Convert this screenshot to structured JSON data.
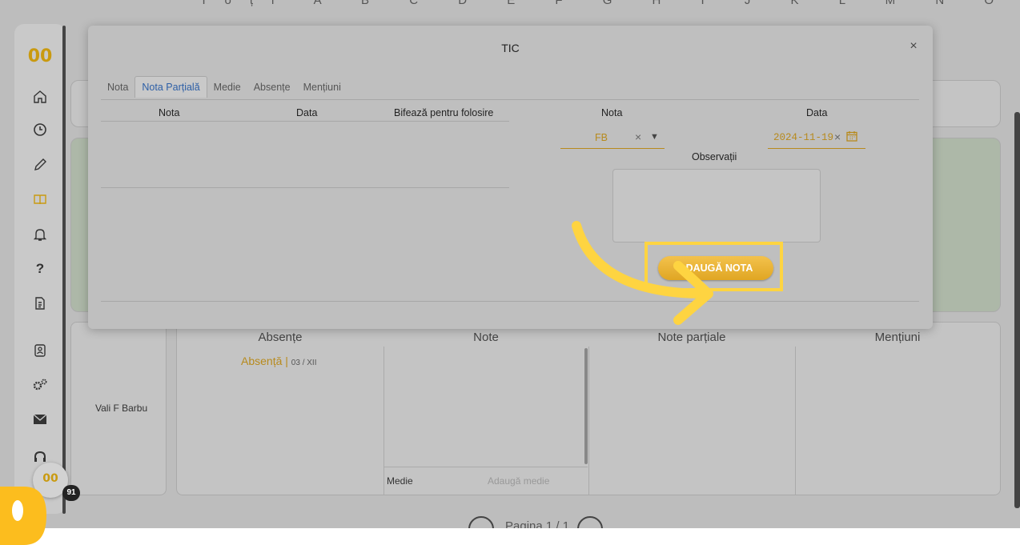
{
  "alphabet": "Toți A B C D E F G H I J K L M N O P Q R S T U V W X Y Z",
  "sidebar": {
    "logo": "00",
    "icons": [
      "home-icon",
      "clock-icon",
      "pencil-icon",
      "book-icon",
      "bell-icon",
      "help-icon",
      "document-icon",
      "contact-card-icon",
      "settings-icon",
      "mail-icon",
      "headset-icon"
    ]
  },
  "background": {
    "columns": [
      "Absențe",
      "Note",
      "Note parțiale",
      "Mențiuni"
    ],
    "student_name": "Vali F Barbu",
    "absence_label": "Absență",
    "absence_date": "03 / XII",
    "medie_label": "Medie",
    "medie_add": "Adaugă medie",
    "pager_text": "Pagina 1 / 1"
  },
  "modal": {
    "title": "TIC",
    "close": "×",
    "tabs": [
      {
        "label": "Nota",
        "active": false
      },
      {
        "label": "Nota Parțială",
        "active": true
      },
      {
        "label": "Medie",
        "active": false
      },
      {
        "label": "Absențe",
        "active": false
      },
      {
        "label": "Mențiuni",
        "active": false
      }
    ],
    "table_headers": [
      "Nota",
      "Data",
      "Bifează pentru folosire"
    ],
    "form": {
      "nota_label": "Nota",
      "nota_value": "FB",
      "data_label": "Data",
      "data_value": "2024-11-19",
      "observatii_label": "Observații",
      "observatii_value": "",
      "submit_label": "ADAUGĂ NOTA"
    }
  },
  "notification_count": "91",
  "colors": {
    "accent": "#f3b937",
    "highlight": "#fed441",
    "tab_active": "#2d5fa6",
    "value_text": "#b78a1d"
  }
}
